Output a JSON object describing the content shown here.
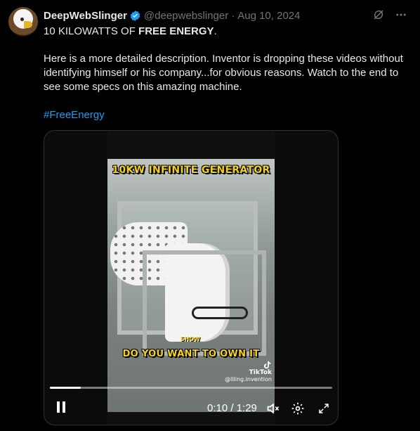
{
  "author": {
    "name": "DeepWebSlinger",
    "handle": "@deepwebslinger",
    "separator": "·",
    "date": "Aug 10, 2024"
  },
  "post": {
    "line1_prefix": "10 KILOWATTS OF ",
    "line1_bold": "FREE ENERGY",
    "line1_suffix": ".",
    "paragraph": "Here is a more detailed description. Inventor is dropping these videos without identifying himself or his company...for obvious reasons. Watch to the end to see some specs on this amazing machine.",
    "hashtag": "#FreeEnergy"
  },
  "video": {
    "caption_top": "10KW INFINITE GENERATOR",
    "caption_small": "SHOW",
    "caption_bottom": "DO YOU WANT TO OWN IT",
    "watermark_brand": "TikTok",
    "watermark_user": "@liling.invention",
    "progress": 0.11,
    "time": "0:10 / 1:29"
  },
  "icons": [
    "verified-badge-icon",
    "grok-icon",
    "more-icon",
    "pause-icon",
    "mute-icon",
    "settings-icon",
    "fullscreen-icon",
    "tiktok-logo-icon"
  ],
  "colors": {
    "accent": "#1d9bf0",
    "secondary_text": "#71767b",
    "caption_yellow": "#f7d21a"
  }
}
